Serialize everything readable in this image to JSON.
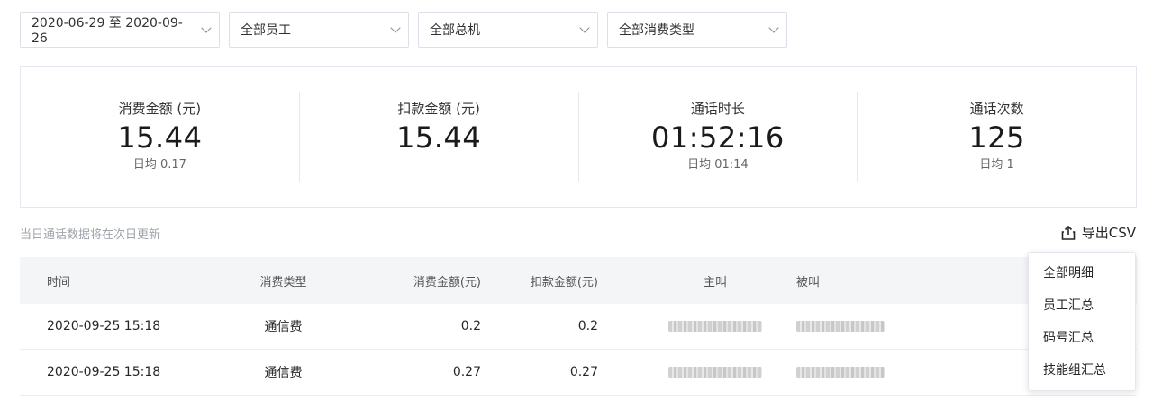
{
  "filters": {
    "date_range": "2020-06-29 至 2020-09-26",
    "employee": "全部员工",
    "host": "全部总机",
    "consume_type": "全部消费类型"
  },
  "summary": [
    {
      "label": "消费金额 (元)",
      "value": "15.44",
      "sub": "日均 0.17"
    },
    {
      "label": "扣款金额 (元)",
      "value": "15.44",
      "sub": ""
    },
    {
      "label": "通话时长",
      "value": "01:52:16",
      "sub": "日均 01:14"
    },
    {
      "label": "通话次数",
      "value": "125",
      "sub": "日均 1"
    }
  ],
  "note": "当日通话数据将在次日更新",
  "export": {
    "label": "导出CSV",
    "icon": "export-icon"
  },
  "table": {
    "headers": {
      "time": "时间",
      "type": "消费类型",
      "amount": "消费金额(元)",
      "deduct": "扣款金额(元)",
      "caller": "主叫",
      "callee": "被叫"
    },
    "rows": [
      {
        "time": "2020-09-25 15:18",
        "type": "通信费",
        "amount": "0.2",
        "deduct": "0.2"
      },
      {
        "time": "2020-09-25 15:18",
        "type": "通信费",
        "amount": "0.27",
        "deduct": "0.27"
      }
    ]
  },
  "export_menu": {
    "items": [
      "全部明细",
      "员工汇总",
      "码号汇总",
      "技能组汇总"
    ]
  }
}
